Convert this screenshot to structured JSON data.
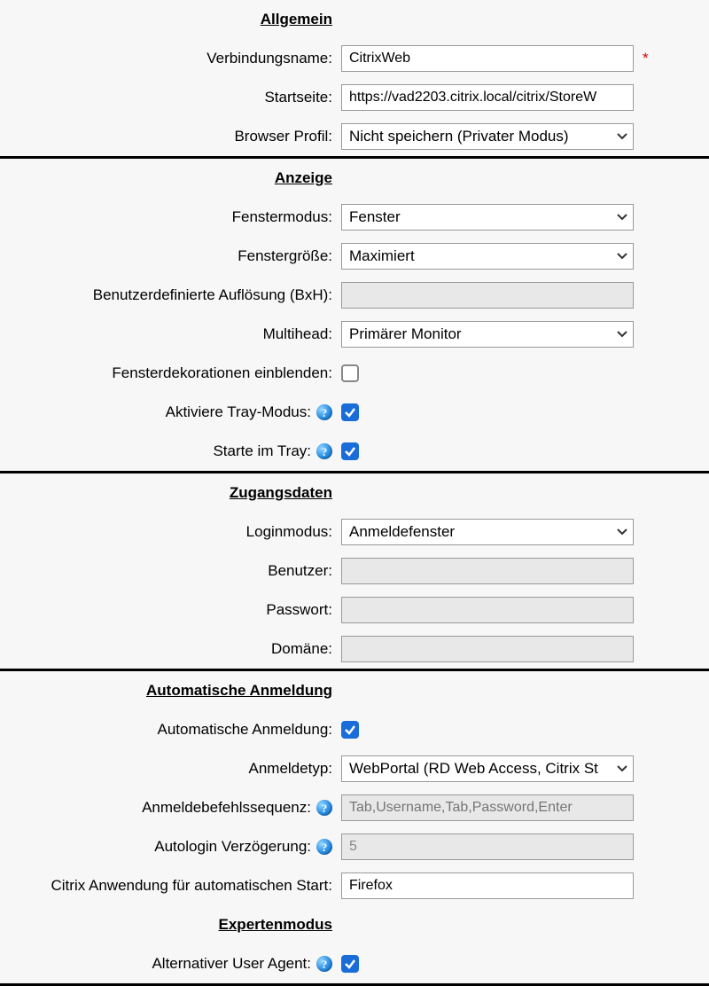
{
  "sections": {
    "general": "Allgemein",
    "display": "Anzeige",
    "credentials": "Zugangsdaten",
    "autologin": "Automatische Anmeldung",
    "expert": "Expertenmodus"
  },
  "general": {
    "connection_name_label": "Verbindungsname:",
    "connection_name_value": "CitrixWeb",
    "startpage_label": "Startseite:",
    "startpage_value": "https://vad2203.citrix.local/citrix/StoreW",
    "browser_profile_label": "Browser Profil:",
    "browser_profile_value": "Nicht speichern (Privater Modus)",
    "required_mark": "*"
  },
  "display": {
    "window_mode_label": "Fenstermodus:",
    "window_mode_value": "Fenster",
    "window_size_label": "Fenstergröße:",
    "window_size_value": "Maximiert",
    "custom_res_label": "Benutzerdefinierte Auflösung (BxH):",
    "custom_res_value": "",
    "multihead_label": "Multihead:",
    "multihead_value": "Primärer Monitor",
    "decorations_label": "Fensterdekorationen einblenden:",
    "decorations_checked": false,
    "tray_mode_label": "Aktiviere Tray-Modus:",
    "tray_mode_checked": true,
    "start_tray_label": "Starte im Tray:",
    "start_tray_checked": true
  },
  "credentials": {
    "login_mode_label": "Loginmodus:",
    "login_mode_value": "Anmeldefenster",
    "user_label": "Benutzer:",
    "user_value": "",
    "password_label": "Passwort:",
    "password_value": "",
    "domain_label": "Domäne:",
    "domain_value": ""
  },
  "autologin": {
    "auto_login_label": "Automatische Anmeldung:",
    "auto_login_checked": true,
    "login_type_label": "Anmeldetyp:",
    "login_type_value": "WebPortal (RD Web Access, Citrix St",
    "login_seq_label": "Anmeldebefehlssequenz:",
    "login_seq_placeholder": "Tab,Username,Tab,Password,Enter",
    "autologin_delay_label": "Autologin Verzögerung:",
    "autologin_delay_value": "5",
    "citrix_app_label": "Citrix Anwendung für automatischen Start:",
    "citrix_app_value": "Firefox"
  },
  "expert": {
    "alt_ua_label": "Alternativer User Agent:",
    "alt_ua_checked": true
  },
  "help_glyph": "?"
}
